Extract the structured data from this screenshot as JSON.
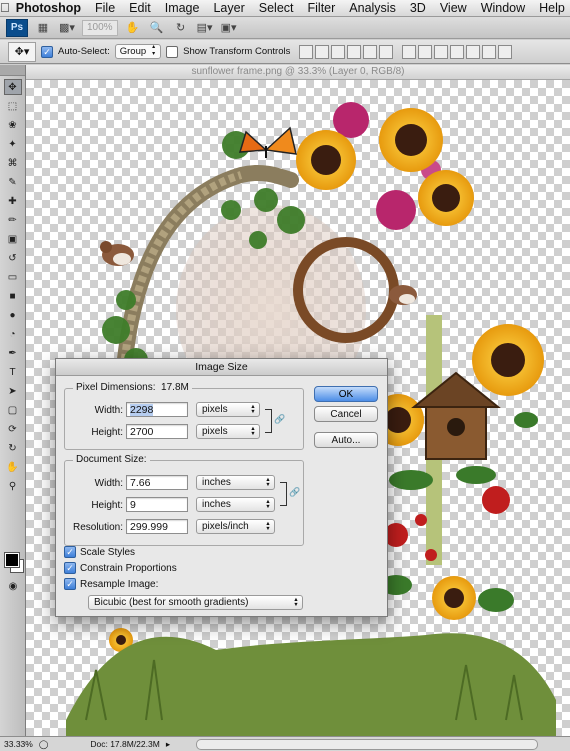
{
  "menubar": {
    "apple_icon": "apple-icon",
    "app_name": "Photoshop",
    "items": [
      "File",
      "Edit",
      "Image",
      "Layer",
      "Select",
      "Filter",
      "Analysis",
      "3D",
      "View",
      "Window",
      "Help"
    ]
  },
  "appbar": {
    "logo": "Ps",
    "zoom": "100%"
  },
  "options": {
    "auto_select_label": "Auto-Select:",
    "auto_select_value": "Group",
    "show_transform_label": "Show Transform Controls"
  },
  "document": {
    "title": "sunflower frame.png @ 33.3% (Layer 0, RGB/8)"
  },
  "statusbar": {
    "zoom": "33.33%",
    "doc_info": "Doc: 17.8M/22.3M"
  },
  "dialog": {
    "title": "Image Size",
    "pixel_dimensions": {
      "heading": "Pixel Dimensions:",
      "size": "17.8M",
      "width_label": "Width:",
      "width_value": "2298",
      "width_unit": "pixels",
      "height_label": "Height:",
      "height_value": "2700",
      "height_unit": "pixels"
    },
    "document_size": {
      "heading": "Document Size:",
      "width_label": "Width:",
      "width_value": "7.66",
      "width_unit": "inches",
      "height_label": "Height:",
      "height_value": "9",
      "height_unit": "inches",
      "resolution_label": "Resolution:",
      "resolution_value": "299.999",
      "resolution_unit": "pixels/inch"
    },
    "scale_styles": "Scale Styles",
    "constrain_proportions": "Constrain Proportions",
    "resample_image": "Resample Image:",
    "resample_method": "Bicubic (best for smooth gradients)",
    "ok": "OK",
    "cancel": "Cancel",
    "auto": "Auto..."
  }
}
